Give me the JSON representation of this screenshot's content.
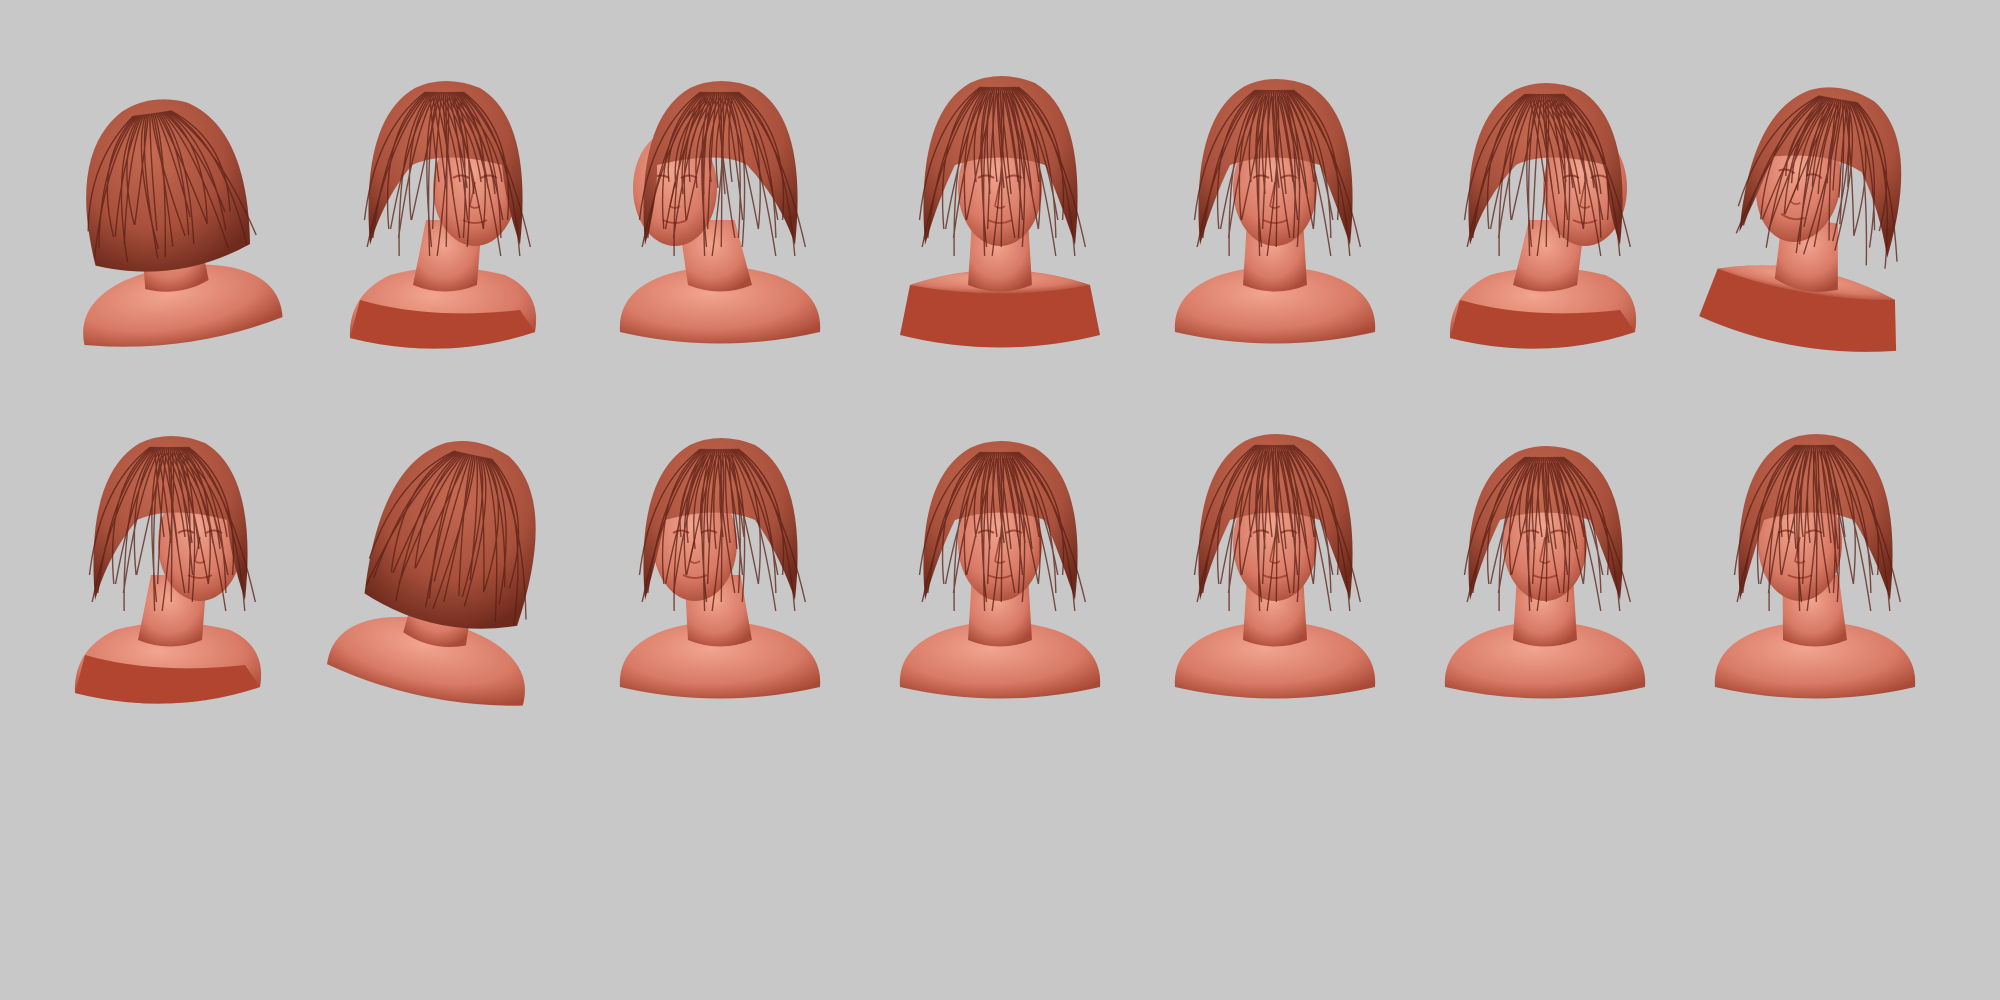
{
  "scene": {
    "background_color": "#c8c8c8",
    "material": {
      "skin": "#d87a66",
      "skin_light": "#f2a58f",
      "skin_shadow": "#a94a36",
      "hair": "#a8503c",
      "hair_dark": "#6e2a1c",
      "hair_strand": "#5a1f14",
      "cut_face": "#b24530"
    },
    "rows": [
      {
        "views": [
          {
            "view": "back-left"
          },
          {
            "view": "three-quarter-right"
          },
          {
            "view": "profile-left"
          },
          {
            "view": "front-low"
          },
          {
            "view": "front"
          },
          {
            "view": "back-three-quarter-right"
          },
          {
            "view": "three-quarter-left-high"
          }
        ]
      },
      {
        "views": [
          {
            "view": "three-quarter-right"
          },
          {
            "view": "top-back"
          },
          {
            "view": "three-quarter-left"
          },
          {
            "view": "front-high"
          },
          {
            "view": "front"
          },
          {
            "view": "top-down"
          },
          {
            "view": "three-quarter-left-low"
          }
        ]
      }
    ]
  }
}
